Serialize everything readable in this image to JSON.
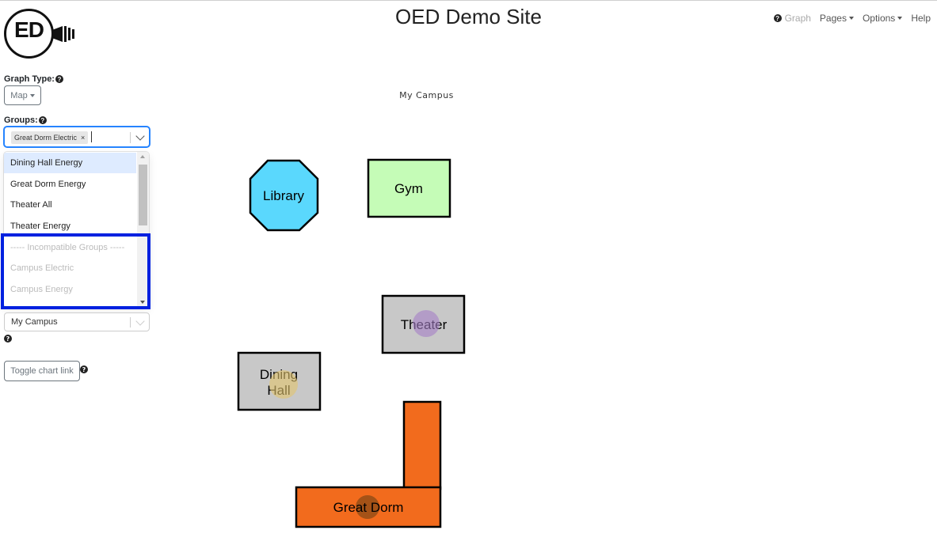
{
  "header": {
    "logo_text": "ED",
    "title": "OED Demo Site",
    "nav": [
      {
        "label": "Graph",
        "icon": "help-circle-icon",
        "disabled": true
      },
      {
        "label": "Pages",
        "dropdown": true
      },
      {
        "label": "Options",
        "dropdown": true
      },
      {
        "label": "Help"
      }
    ]
  },
  "sidebar": {
    "graph_type_label": "Graph Type:",
    "graph_type_value": "Map",
    "groups_label": "Groups:",
    "selected_groups": [
      {
        "label": "Great Dorm Electric",
        "remove": "×"
      }
    ],
    "dropdown_options": [
      {
        "label": "Dining Hall Energy",
        "state": "focused"
      },
      {
        "label": "Great Dorm Energy",
        "state": "normal"
      },
      {
        "label": "Theater All",
        "state": "normal"
      },
      {
        "label": "Theater Energy",
        "state": "normal"
      },
      {
        "label": "----- Incompatible Groups -----",
        "state": "disabled"
      },
      {
        "label": "Campus Electric",
        "state": "disabled"
      },
      {
        "label": "Campus Energy",
        "state": "disabled"
      }
    ],
    "map_select_value": "My Campus",
    "toggle_chart_link_label": "Toggle chart link"
  },
  "map": {
    "title": "My Campus",
    "buildings": [
      {
        "name": "Library",
        "fill": "#5ad8fd"
      },
      {
        "name": "Gym",
        "fill": "#c5fcb7"
      },
      {
        "name": "Theater",
        "fill": "#c8c8c8"
      },
      {
        "name_lines": [
          "Dining",
          "Hall"
        ],
        "fill": "#c8c8c8"
      },
      {
        "name": "Great Dorm",
        "fill": "#f26b1d"
      }
    ],
    "markers": [
      {
        "building": "Theater",
        "color": "#a57fc7"
      },
      {
        "building": "Dining Hall",
        "color": "#e3c46c"
      },
      {
        "building": "Great Dorm",
        "color": "#8a4a16"
      }
    ]
  },
  "colors": {
    "highlight_border": "#0021e0",
    "focus_blue": "#2684ff",
    "option_focus_bg": "#deebff"
  }
}
